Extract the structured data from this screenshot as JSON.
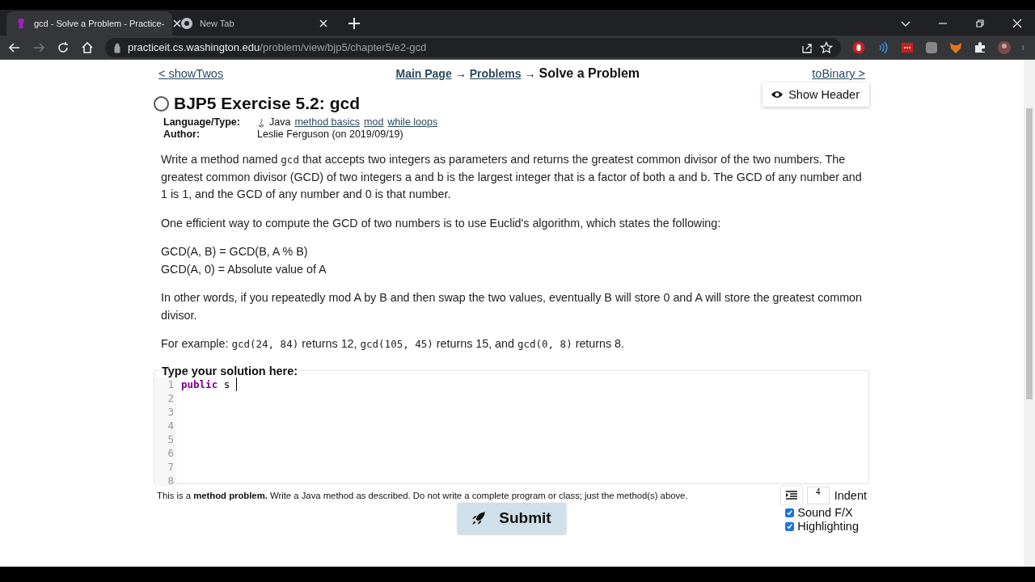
{
  "browser": {
    "tabs": [
      {
        "title": "gcd - Solve a Problem - Practice-",
        "selected": true
      },
      {
        "title": "New Tab",
        "selected": false
      }
    ],
    "url_host": "practiceit.cs.washington.edu",
    "url_path": "/problem/view/bjp5/chapter5/e2-gcd"
  },
  "nav": {
    "prev": "< showTwos",
    "crumbs": [
      "Main Page",
      "Problems"
    ],
    "arrow": "→",
    "current": "Solve a Problem",
    "next": "toBinary >"
  },
  "show_header": "Show Header",
  "problem": {
    "title": "BJP5 Exercise 5.2: gcd",
    "language_label": "Language/Type:",
    "language": "Java",
    "tags": [
      "method basics",
      "mod",
      "while loops"
    ],
    "author_label": "Author:",
    "author": "Leslie Ferguson (on 2019/09/19)"
  },
  "description": [
    [
      {
        "kind": "text",
        "text": "Write a method named "
      },
      {
        "kind": "code",
        "text": "gcd"
      },
      {
        "kind": "text",
        "text": " that accepts two integers as parameters and returns the greatest common divisor of the two numbers. The greatest common divisor (GCD) of two integers a and b is the largest integer that is a factor of both a and b. The GCD of any number and 1 is 1, and the GCD of any number and 0 is that number."
      }
    ],
    [
      {
        "kind": "text",
        "text": "One efficient way to compute the GCD of two numbers is to use Euclid's algorithm, which states the following:"
      }
    ],
    [
      {
        "kind": "text",
        "text": "GCD(A, B) = GCD(B, A % B)"
      },
      {
        "kind": "break"
      },
      {
        "kind": "text",
        "text": "GCD(A, 0) = Absolute value of A"
      }
    ],
    [
      {
        "kind": "text",
        "text": "In other words, if you repeatedly mod A by B and then swap the two values, eventually B will store 0 and A will store the greatest common divisor."
      }
    ],
    [
      {
        "kind": "text",
        "text": "For example: "
      },
      {
        "kind": "code",
        "text": "gcd(24, 84)"
      },
      {
        "kind": "text",
        "text": " returns 12, "
      },
      {
        "kind": "code",
        "text": "gcd(105, 45)"
      },
      {
        "kind": "text",
        "text": " returns 15, and "
      },
      {
        "kind": "code",
        "text": "gcd(0, 8)"
      },
      {
        "kind": "text",
        "text": " returns 8."
      }
    ]
  ],
  "editor": {
    "legend": "Type your solution here:",
    "line_numbers": [
      "1",
      "2",
      "3",
      "4",
      "5",
      "6",
      "7",
      "8"
    ],
    "tokens": [
      {
        "kind": "keyword",
        "text": "public"
      },
      {
        "kind": "plain",
        "text": "s"
      }
    ]
  },
  "note": "This is a **method problem.** Write a Java method as described. Do not write a complete program or class; just the method(s) above.",
  "submit": "Submit",
  "indent": {
    "value": "4",
    "label": "Indent"
  },
  "options": [
    {
      "label": "Sound F/X",
      "checked": true
    },
    {
      "label": "Highlighting",
      "checked": true
    }
  ]
}
